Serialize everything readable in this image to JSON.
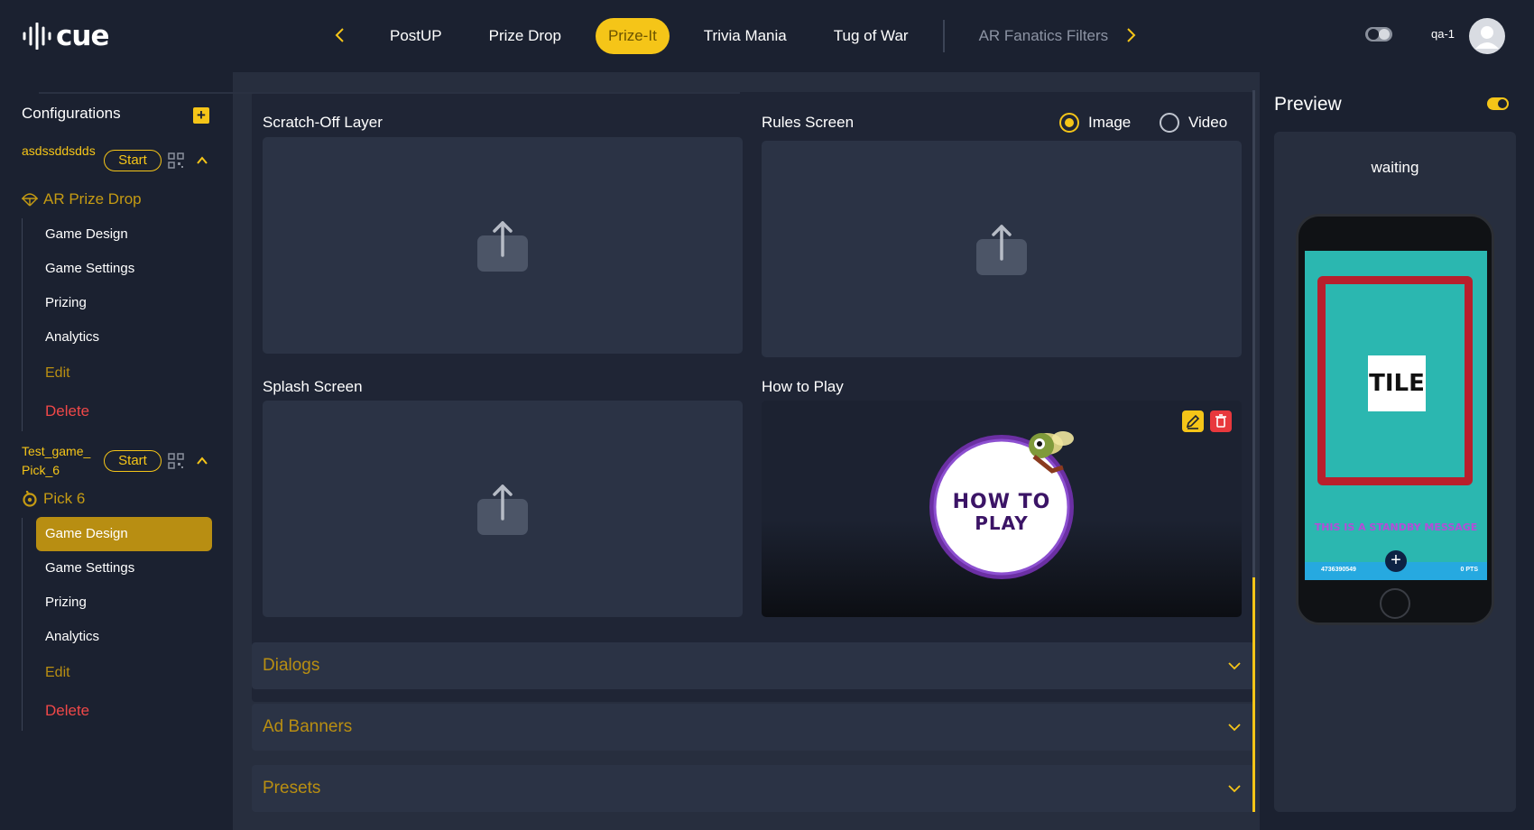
{
  "app": {
    "logo": "cue"
  },
  "nav": {
    "tabs": [
      {
        "label": "PostUP"
      },
      {
        "label": "Prize Drop"
      },
      {
        "label": "Prize-It",
        "active": true
      },
      {
        "label": "Trivia Mania"
      },
      {
        "label": "Tug of War"
      },
      {
        "label": "AR Fanatics Filters",
        "muted": true
      }
    ],
    "user": "qa-1"
  },
  "sidebar": {
    "title": "Configurations",
    "configs": [
      {
        "name": "asdssddsdds",
        "start_label": "Start",
        "type": "AR Prize Drop",
        "items": [
          "Game Design",
          "Game Settings",
          "Prizing",
          "Analytics"
        ],
        "edit": "Edit",
        "delete": "Delete"
      },
      {
        "name": "Test_game_Pick_6",
        "start_label": "Start",
        "type": "Pick 6",
        "items": [
          "Game Design",
          "Game Settings",
          "Prizing",
          "Analytics"
        ],
        "active_item": "Game Design",
        "edit": "Edit",
        "delete": "Delete"
      }
    ]
  },
  "main": {
    "slots": {
      "scratch": "Scratch-Off Layer",
      "rules": "Rules Screen",
      "splash": "Splash Screen",
      "howto": "How to Play"
    },
    "media_options": {
      "image": "Image",
      "video": "Video",
      "selected": "Image"
    },
    "howto_art_text": [
      "HOW TO",
      "PLAY"
    ],
    "sections": [
      "Dialogs",
      "Ad Banners",
      "Presets"
    ]
  },
  "preview": {
    "title": "Preview",
    "status": "waiting",
    "tile": "TILE",
    "standby": "THIS IS A STANDBY MESSAGE",
    "footer_id": "4736390549",
    "footer_pts": "0 PTS"
  },
  "colors": {
    "accent": "#f5c518",
    "accent_dark": "#b88e12",
    "danger": "#f04848",
    "bg": "#1b2130",
    "panel": "#272e3e"
  }
}
